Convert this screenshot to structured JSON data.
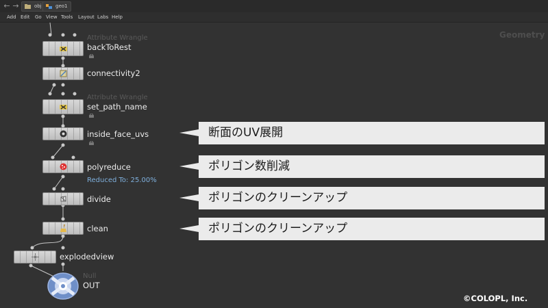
{
  "path": {
    "root": "obj",
    "current": "geo1"
  },
  "menu": [
    "Add",
    "Edit",
    "Go",
    "View",
    "Tools",
    "Layout",
    "Labs",
    "Help"
  ],
  "context_label": "Geometry",
  "nodes": [
    {
      "type": "Attribute Wrangle",
      "name": "backToRest",
      "icon": "wrangle-icon"
    },
    {
      "type": "",
      "name": "connectivity2",
      "icon": "connectivity-icon"
    },
    {
      "type": "Attribute Wrangle",
      "name": "set_path_name",
      "icon": "wrangle-icon"
    },
    {
      "type": "",
      "name": "inside_face_uvs",
      "icon": "uv-icon"
    },
    {
      "type": "",
      "name": "polyreduce",
      "icon": "polyreduce-icon",
      "info": "Reduced To: 25.00%"
    },
    {
      "type": "",
      "name": "divide",
      "icon": "divide-icon"
    },
    {
      "type": "",
      "name": "clean",
      "icon": "clean-icon"
    },
    {
      "type": "",
      "name": "explodedview",
      "icon": "explode-icon"
    },
    {
      "type": "Null",
      "name": "OUT",
      "icon": "null-out-icon"
    }
  ],
  "annotations": [
    "断面のUV展開",
    "ポリゴン数削減",
    "ポリゴンのクリーンアップ",
    "ポリゴンのクリーンアップ"
  ],
  "copyright": "©COLOPL, Inc.",
  "colors": {
    "background": "#323232",
    "node": "#c9c9c9",
    "callout": "#ebebeb",
    "info": "#7fb0dd"
  }
}
